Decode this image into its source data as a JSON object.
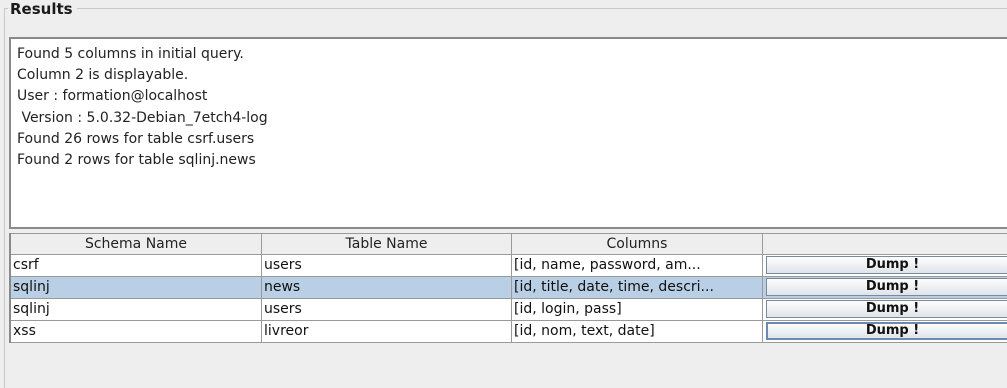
{
  "panel": {
    "title": "Results"
  },
  "log": {
    "lines": [
      "Found 5 columns in initial query.",
      "Column 2 is displayable.",
      "User : formation@localhost",
      " Version : 5.0.32-Debian_7etch4-log",
      "Found 26 rows for table csrf.users",
      "Found 2 rows for table sqlinj.news"
    ]
  },
  "table": {
    "headers": [
      "Schema Name",
      "Table Name",
      "Columns",
      ""
    ],
    "rows": [
      {
        "schema": "csrf",
        "table": "users",
        "columns": "[id, name, password, am...",
        "action": "Dump !"
      },
      {
        "schema": "sqlinj",
        "table": "news",
        "columns": "[id, title, date, time, descri...",
        "action": "Dump !",
        "selected": true
      },
      {
        "schema": "sqlinj",
        "table": "users",
        "columns": "[id, login, pass]",
        "action": "Dump !"
      },
      {
        "schema": "xss",
        "table": "livreor",
        "columns": "[id, nom, text, date]",
        "action": "Dump !",
        "focused": true
      }
    ]
  },
  "colors": {
    "selection": "#b8cfe5",
    "background": "#eeeeee",
    "border": "#8a8a8a"
  }
}
